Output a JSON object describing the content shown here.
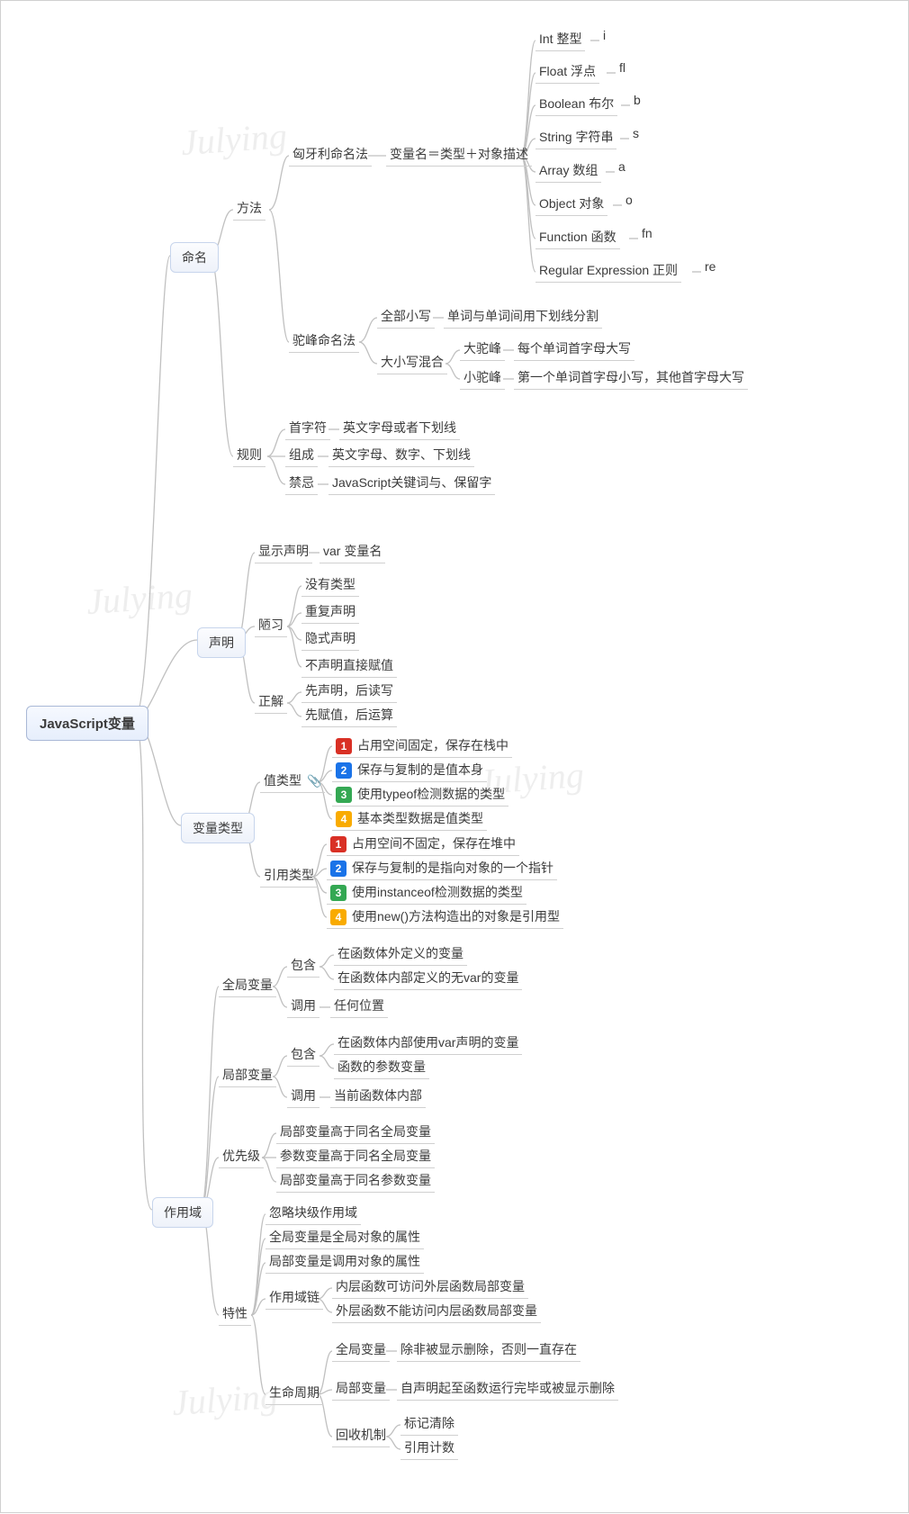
{
  "root": "JavaScript变量",
  "naming": {
    "label": "命名",
    "method": {
      "label": "方法",
      "hungarian": {
        "label": "匈牙利命名法",
        "detail": "变量名＝类型＋对象描述",
        "types": [
          {
            "t": "Int 整型",
            "s": "i"
          },
          {
            "t": "Float 浮点",
            "s": "fl"
          },
          {
            "t": "Boolean 布尔",
            "s": "b"
          },
          {
            "t": "String 字符串",
            "s": "s"
          },
          {
            "t": "Array 数组",
            "s": "a"
          },
          {
            "t": "Object 对象",
            "s": "o"
          },
          {
            "t": "Function 函数",
            "s": "fn"
          },
          {
            "t": "Regular Expression 正则",
            "s": "re"
          }
        ]
      },
      "camel": {
        "label": "驼峰命名法",
        "all_lower": {
          "label": "全部小写",
          "detail": "单词与单词间用下划线分割"
        },
        "mixed": {
          "label": "大小写混合",
          "big": {
            "label": "大驼峰",
            "detail": "每个单词首字母大写"
          },
          "small": {
            "label": "小驼峰",
            "detail": "第一个单词首字母小写，其他首字母大写"
          }
        }
      }
    },
    "rule": {
      "label": "规则",
      "first": {
        "label": "首字符",
        "detail": "英文字母或者下划线"
      },
      "compose": {
        "label": "组成",
        "detail": "英文字母、数字、下划线"
      },
      "taboo": {
        "label": "禁忌",
        "detail": "JavaScript关键词与、保留字"
      }
    }
  },
  "declare": {
    "label": "声明",
    "explicit": {
      "label": "显示声明",
      "detail": "var 变量名"
    },
    "bad": {
      "label": "陋习",
      "items": [
        "没有类型",
        "重复声明",
        "隐式声明",
        "不声明直接赋值"
      ]
    },
    "correct": {
      "label": "正解",
      "items": [
        "先声明，后读写",
        "先赋值，后运算"
      ]
    }
  },
  "types": {
    "label": "变量类型",
    "value": {
      "label": "值类型",
      "items": [
        "占用空间固定，保存在栈中",
        "保存与复制的是值本身",
        "使用typeof检测数据的类型",
        "基本类型数据是值类型"
      ]
    },
    "ref": {
      "label": "引用类型",
      "items": [
        "占用空间不固定，保存在堆中",
        "保存与复制的是指向对象的一个指针",
        "使用instanceof检测数据的类型",
        "使用new()方法构造出的对象是引用型"
      ]
    }
  },
  "scope": {
    "label": "作用域",
    "global": {
      "label": "全局变量",
      "include": {
        "label": "包含",
        "items": [
          "在函数体外定义的变量",
          "在函数体内部定义的无var的变量"
        ]
      },
      "call": {
        "label": "调用",
        "detail": "任何位置"
      }
    },
    "local": {
      "label": "局部变量",
      "include": {
        "label": "包含",
        "items": [
          "在函数体内部使用var声明的变量",
          "函数的参数变量"
        ]
      },
      "call": {
        "label": "调用",
        "detail": "当前函数体内部"
      }
    },
    "priority": {
      "label": "优先级",
      "items": [
        "局部变量高于同名全局变量",
        "参数变量高于同名全局变量",
        "局部变量高于同名参数变量"
      ]
    },
    "feature": {
      "label": "特性",
      "items1": [
        "忽略块级作用域",
        "全局变量是全局对象的属性",
        "局部变量是调用对象的属性"
      ],
      "chain": {
        "label": "作用域链",
        "items": [
          "内层函数可访问外层函数局部变量",
          "外层函数不能访问内层函数局部变量"
        ]
      },
      "life": {
        "label": "生命周期",
        "global": {
          "label": "全局变量",
          "detail": "除非被显示删除，否则一直存在"
        },
        "local": {
          "label": "局部变量",
          "detail": "自声明起至函数运行完毕或被显示删除"
        },
        "gc": {
          "label": "回收机制",
          "items": [
            "标记清除",
            "引用计数"
          ]
        }
      }
    }
  }
}
